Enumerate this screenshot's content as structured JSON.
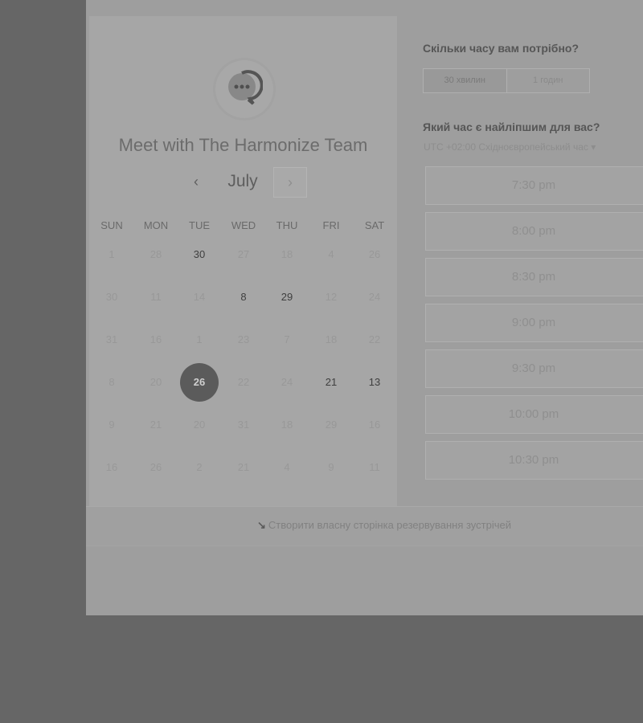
{
  "organizer": {
    "title": "Meet with The Harmonize Team",
    "avatar_icon": "chat-bubble-icon"
  },
  "calendar": {
    "month": "July",
    "prev_icon": "‹",
    "next_icon": "›",
    "weekdays": [
      "SUN",
      "MON",
      "TUE",
      "WED",
      "THU",
      "FRI",
      "SAT"
    ],
    "weeks": [
      [
        {
          "d": "1",
          "a": false
        },
        {
          "d": "28",
          "a": false
        },
        {
          "d": "30",
          "a": true
        },
        {
          "d": "27",
          "a": false
        },
        {
          "d": "18",
          "a": false
        },
        {
          "d": "4",
          "a": false
        },
        {
          "d": "26",
          "a": false
        }
      ],
      [
        {
          "d": "30",
          "a": false
        },
        {
          "d": "11",
          "a": false
        },
        {
          "d": "14",
          "a": false
        },
        {
          "d": "8",
          "a": true
        },
        {
          "d": "29",
          "a": true
        },
        {
          "d": "12",
          "a": false
        },
        {
          "d": "24",
          "a": false
        }
      ],
      [
        {
          "d": "31",
          "a": false
        },
        {
          "d": "16",
          "a": false
        },
        {
          "d": "1",
          "a": false
        },
        {
          "d": "23",
          "a": false
        },
        {
          "d": "7",
          "a": false
        },
        {
          "d": "18",
          "a": false
        },
        {
          "d": "22",
          "a": false
        }
      ],
      [
        {
          "d": "8",
          "a": false
        },
        {
          "d": "20",
          "a": false
        },
        {
          "d": "26",
          "a": true,
          "s": true
        },
        {
          "d": "22",
          "a": false
        },
        {
          "d": "24",
          "a": false
        },
        {
          "d": "21",
          "a": true
        },
        {
          "d": "13",
          "a": true
        }
      ],
      [
        {
          "d": "9",
          "a": false
        },
        {
          "d": "21",
          "a": false
        },
        {
          "d": "20",
          "a": false
        },
        {
          "d": "31",
          "a": false
        },
        {
          "d": "18",
          "a": false
        },
        {
          "d": "29",
          "a": false
        },
        {
          "d": "16",
          "a": false
        }
      ],
      [
        {
          "d": "16",
          "a": false
        },
        {
          "d": "26",
          "a": false
        },
        {
          "d": "2",
          "a": false
        },
        {
          "d": "21",
          "a": false
        },
        {
          "d": "4",
          "a": false
        },
        {
          "d": "9",
          "a": false
        },
        {
          "d": "11",
          "a": false
        }
      ]
    ]
  },
  "duration": {
    "question": "Скільки часу вам потрібно?",
    "options": [
      "30 хвилин",
      "1 годин"
    ],
    "selected": 0
  },
  "time_select": {
    "question": "Який час є найліпшим для вас?",
    "timezone": "UTC +02:00 Східноєвропейський час ▾",
    "slots": [
      "7:30 pm",
      "8:00 pm",
      "8:30 pm",
      "9:00 pm",
      "9:30 pm",
      "10:00 pm",
      "10:30 pm"
    ]
  },
  "footer": {
    "arrow": "↘",
    "link": "Створити власну сторінка резервування зустрічей"
  }
}
